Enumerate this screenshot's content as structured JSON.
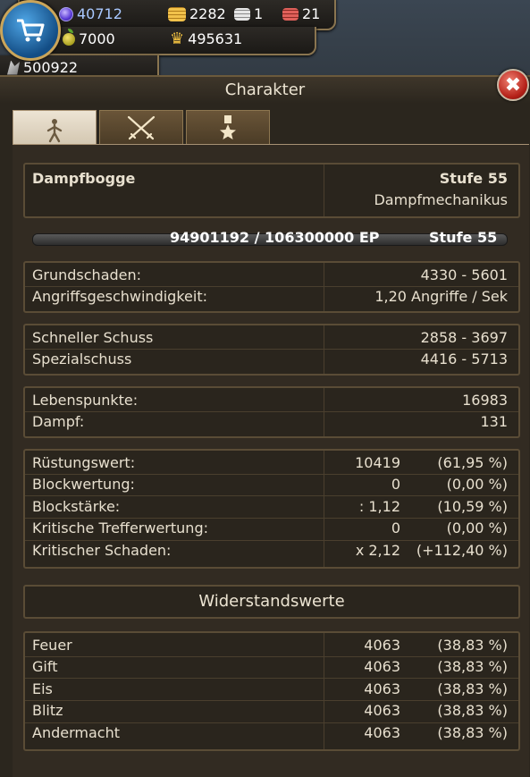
{
  "resources": {
    "gems": "40712",
    "gold": "2282",
    "silver": "1",
    "rubies": "21",
    "apples": "7000",
    "honor": "495631",
    "steam": "500922"
  },
  "panel": {
    "title": "Charakter",
    "close_label": "✖",
    "tabs": [
      {
        "icon": "walking-figure-icon"
      },
      {
        "icon": "crossed-swords-icon"
      },
      {
        "icon": "medal-icon"
      }
    ]
  },
  "character": {
    "name": "Dampfbogge",
    "level_label": "Stufe  55",
    "class": "Dampfmechanikus",
    "xp_text": "94901192  /  106300000  EP",
    "xp_level": "Stufe  55",
    "xp_progress": 0.893
  },
  "damage": [
    {
      "label": "Grundschaden:",
      "value": "4330  -  5601"
    },
    {
      "label": "Angriffsgeschwindigkeit:",
      "value": "1,20  Angriffe  /  Sek"
    }
  ],
  "skills": [
    {
      "label": "Schneller  Schuss",
      "value": "2858  -  3697"
    },
    {
      "label": "Spezialschuss",
      "value": "4416  -  5713"
    }
  ],
  "vitals": [
    {
      "label": "Lebenspunkte:",
      "value": "16983"
    },
    {
      "label": "Dampf:",
      "value": "131"
    }
  ],
  "defense": [
    {
      "label": "Rüstungswert:",
      "value": "10419",
      "pct": "(61,95  %)"
    },
    {
      "label": "Blockwertung:",
      "value": "0",
      "pct": "(0,00  %)"
    },
    {
      "label": "Blockstärke:",
      "value": ":  1,12",
      "pct": "(10,59  %)"
    },
    {
      "label": "Kritische  Trefferwertung:",
      "value": "0",
      "pct": "(0,00  %)"
    },
    {
      "label": "Kritischer  Schaden:",
      "value": "x  2,12",
      "pct": "(+112,40  %)"
    }
  ],
  "resistances_title": "Widerstandswerte",
  "resistances": [
    {
      "label": "Feuer",
      "value": "4063",
      "pct": "(38,83  %)"
    },
    {
      "label": "Gift",
      "value": "4063",
      "pct": "(38,83  %)"
    },
    {
      "label": "Eis",
      "value": "4063",
      "pct": "(38,83  %)"
    },
    {
      "label": "Blitz",
      "value": "4063",
      "pct": "(38,83  %)"
    },
    {
      "label": "Andermacht",
      "value": "4063",
      "pct": "(38,83  %)"
    }
  ],
  "colors": {
    "accent": "#caa55a",
    "panel": "#2b261e",
    "close": "#b42018"
  }
}
